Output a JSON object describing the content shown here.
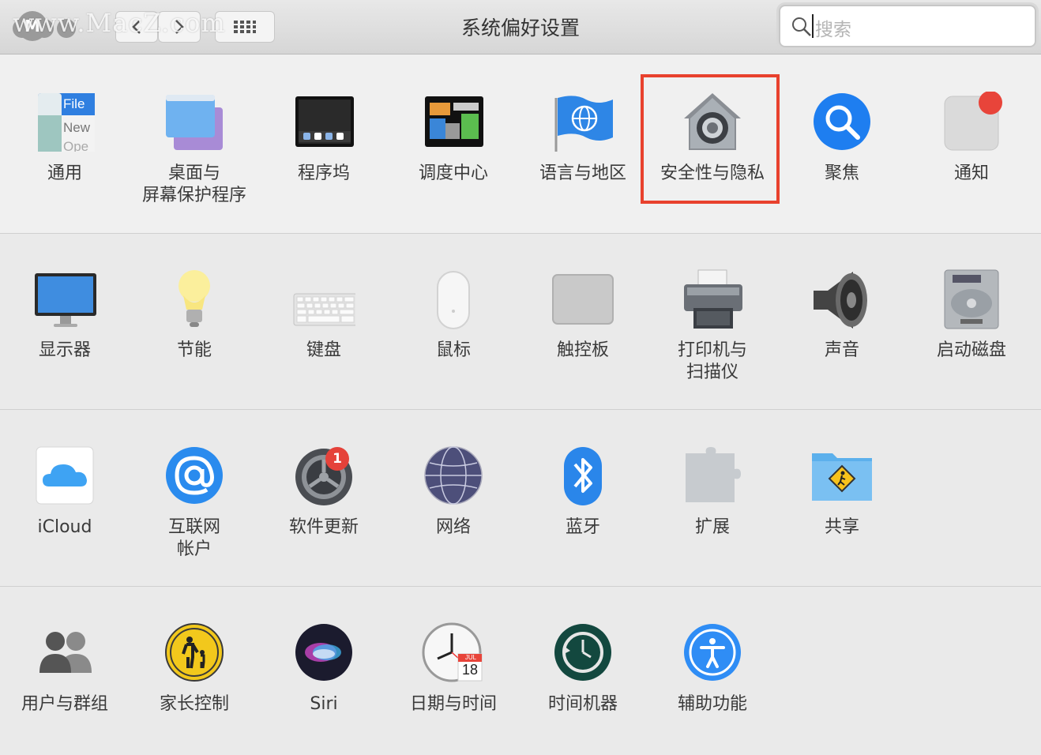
{
  "window": {
    "title": "系统偏好设置",
    "watermark": "www.MacZ.com",
    "logo_letter": "M",
    "search_placeholder": "搜索"
  },
  "toolbar": {
    "back_icon": "chevron-left-icon",
    "forward_icon": "chevron-right-icon",
    "grid_icon": "grid-icon"
  },
  "sections": [
    {
      "panes": [
        {
          "label": "通用",
          "icon": "general-icon"
        },
        {
          "label": "桌面与\n屏幕保护程序",
          "icon": "desktop-screensaver-icon"
        },
        {
          "label": "程序坞",
          "icon": "dock-icon"
        },
        {
          "label": "调度中心",
          "icon": "mission-control-icon"
        },
        {
          "label": "语言与地区",
          "icon": "language-region-icon"
        },
        {
          "label": "安全性与隐私",
          "icon": "security-privacy-icon",
          "highlighted": true
        },
        {
          "label": "聚焦",
          "icon": "spotlight-icon"
        },
        {
          "label": "通知",
          "icon": "notifications-icon"
        }
      ]
    },
    {
      "panes": [
        {
          "label": "显示器",
          "icon": "displays-icon"
        },
        {
          "label": "节能",
          "icon": "energy-saver-icon"
        },
        {
          "label": "键盘",
          "icon": "keyboard-icon"
        },
        {
          "label": "鼠标",
          "icon": "mouse-icon"
        },
        {
          "label": "触控板",
          "icon": "trackpad-icon"
        },
        {
          "label": "打印机与\n扫描仪",
          "icon": "printer-icon"
        },
        {
          "label": "声音",
          "icon": "sound-icon"
        },
        {
          "label": "启动磁盘",
          "icon": "startup-disk-icon"
        }
      ]
    },
    {
      "panes": [
        {
          "label": "iCloud",
          "icon": "icloud-icon"
        },
        {
          "label": "互联网\n帐户",
          "icon": "internet-accounts-icon"
        },
        {
          "label": "软件更新",
          "icon": "software-update-icon",
          "badge": "1"
        },
        {
          "label": "网络",
          "icon": "network-icon"
        },
        {
          "label": "蓝牙",
          "icon": "bluetooth-icon"
        },
        {
          "label": "扩展",
          "icon": "extensions-icon"
        },
        {
          "label": "共享",
          "icon": "sharing-icon"
        }
      ]
    },
    {
      "panes": [
        {
          "label": "用户与群组",
          "icon": "users-groups-icon"
        },
        {
          "label": "家长控制",
          "icon": "parental-controls-icon"
        },
        {
          "label": "Siri",
          "icon": "siri-icon"
        },
        {
          "label": "日期与时间",
          "icon": "date-time-icon",
          "calendar_month": "JUL",
          "calendar_day": "18"
        },
        {
          "label": "时间机器",
          "icon": "time-machine-icon"
        },
        {
          "label": "辅助功能",
          "icon": "accessibility-icon"
        }
      ]
    }
  ],
  "general_icon_text": {
    "file": "File",
    "new": "New",
    "open": "Ope"
  },
  "colors": {
    "highlight": "#e8412d",
    "badge": "#e5423a",
    "accent": "#2f8df5"
  }
}
